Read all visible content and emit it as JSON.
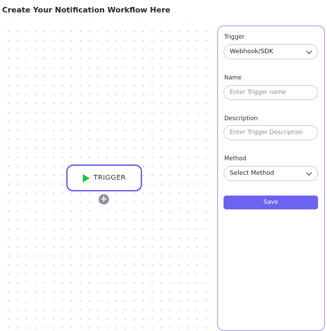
{
  "header": {
    "title": "Create Your Notification Workflow Here"
  },
  "canvas": {
    "trigger_node": {
      "label": "TRIGGER",
      "icon": "play-icon"
    },
    "add_node": {
      "label": "+",
      "icon": "plus-circle-icon"
    }
  },
  "panel": {
    "trigger": {
      "label": "Trigger",
      "value": "Webhook/SDK"
    },
    "name": {
      "label": "Name",
      "placeholder": "Enter Trigger name",
      "value": ""
    },
    "description": {
      "label": "Description",
      "placeholder": "Enter Trigger Description",
      "value": ""
    },
    "method": {
      "label": "Method",
      "value": "Select Method"
    },
    "save_label": "Save"
  },
  "colors": {
    "accent": "#6c63f0",
    "play": "#22c23a",
    "add_button": "#8a8f9a",
    "panel_border": "#9a94f0"
  }
}
